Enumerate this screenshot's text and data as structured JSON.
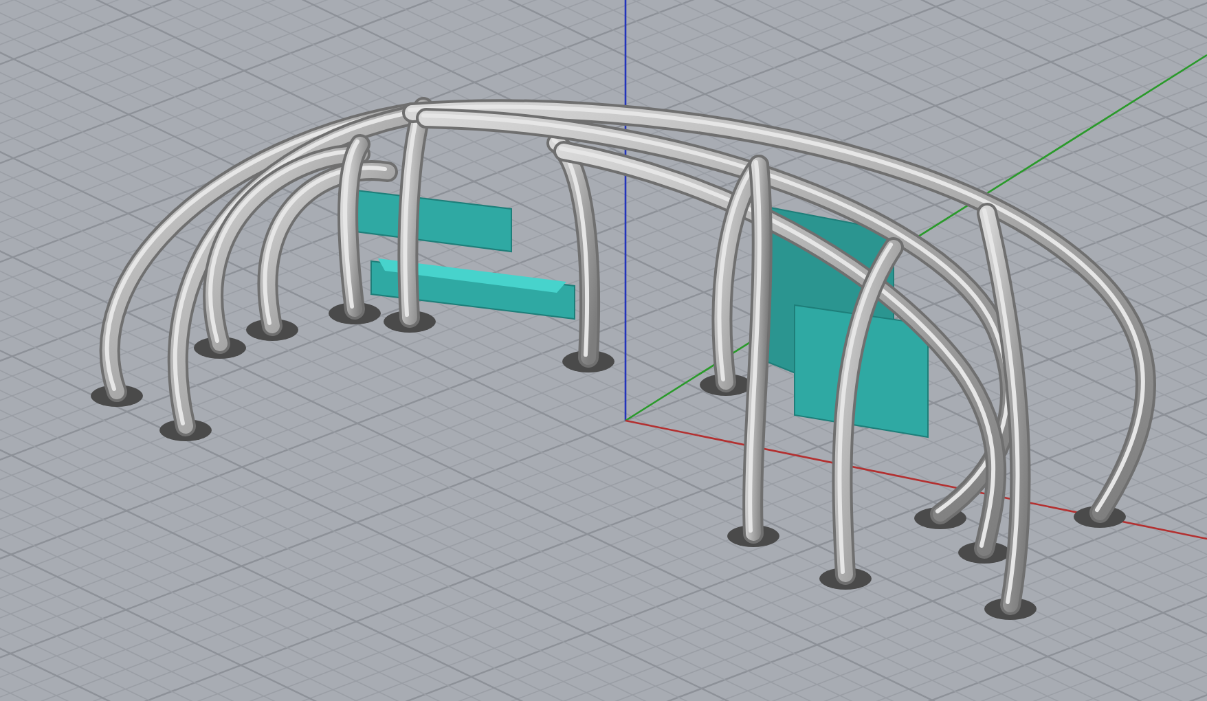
{
  "viewport": {
    "grid": true,
    "world_axes": true
  }
}
